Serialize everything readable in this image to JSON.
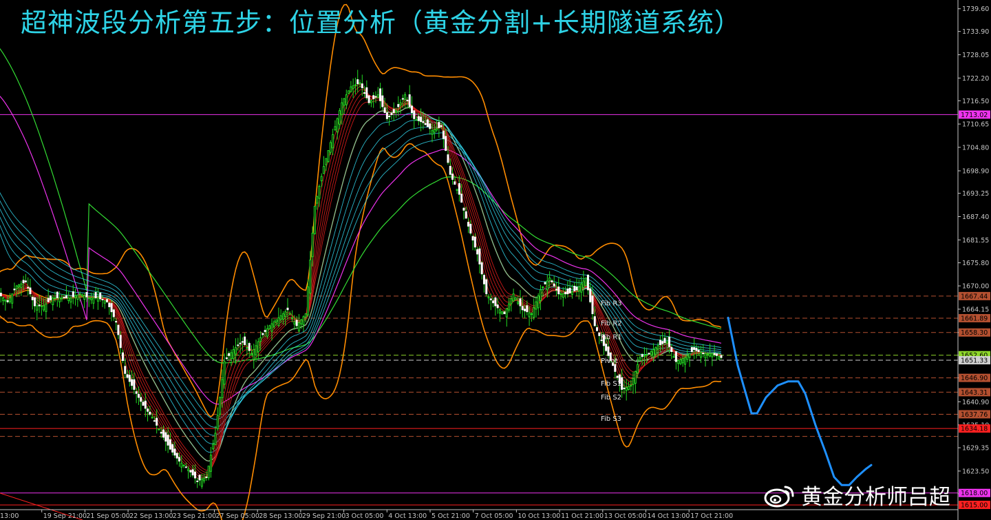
{
  "title": "超神波段分析第五步：位置分析（黄金分割+长期隧道系统）",
  "watermark": "黄金分析师吕超",
  "watermark_icon": "weibo-logo-icon",
  "colors": {
    "background": "#000000",
    "title": "#2ed3e6",
    "axis": "#c8c8c8",
    "bull_candle": "#22dd22",
    "bear_candle": "#ffffff",
    "bollinger": "#ff8c00",
    "ma_green": "#33dd33",
    "ma_magenta": "#ee33ee",
    "tunnel_cyan": "#33d8ee",
    "fast_red": "#cc1a1a",
    "forecast": "#1e90ff",
    "hline_brown": "#b45030",
    "hline_red": "#ff2020",
    "hline_magenta": "#ee33ee"
  },
  "chart_data": {
    "type": "candlestick",
    "title": "",
    "xlabel": "",
    "ylabel": "",
    "ylim": [
      1613.8,
      1741.8
    ],
    "x_ticks": [
      "13:00",
      "19 Sep 21:00",
      "21 Sep 05:00",
      "22 Sep 13:00",
      "23 Sep 21:00",
      "27 Sep 05:00",
      "28 Sep 13:00",
      "29 Sep 21:00",
      "3 Oct 05:00",
      "4 Oct 13:00",
      "5 Oct 21:00",
      "7 Oct 05:00",
      "10 Oct 13:00",
      "11 Oct 21:00",
      "13 Oct 05:00",
      "14 Oct 13:00",
      "17 Oct 21:00"
    ],
    "y_ticks": [
      "1739.60",
      "1733.90",
      "1728.05",
      "1722.20",
      "1716.50",
      "1710.65",
      "1704.80",
      "1698.90",
      "1693.25",
      "1687.40",
      "1681.55",
      "1675.80",
      "1670.00",
      "1664.15",
      "1658.30",
      "1652.60",
      "1646.90",
      "1640.90",
      "1635.10",
      "1629.35",
      "1623.50",
      "1617.80"
    ],
    "price_levels": [
      {
        "value": 1713.02,
        "label": "1713.02",
        "color": "#ee33ee",
        "style": "solid"
      },
      {
        "value": 1667.44,
        "label": "1667.44",
        "color": "#b45030",
        "style": "dashed"
      },
      {
        "value": 1661.89,
        "label": "1661.89",
        "color": "#b45030",
        "style": "dashed"
      },
      {
        "value": 1658.3,
        "label": "1658.30",
        "color": "#b45030",
        "style": "dashed"
      },
      {
        "value": 1652.6,
        "label": "1652.60",
        "color": "#8fd82a",
        "style": "dashed"
      },
      {
        "value": 1651.33,
        "label": "1651.33",
        "color": "#d0d0d0",
        "style": "dashed"
      },
      {
        "value": 1646.9,
        "label": "1646.90",
        "color": "#b45030",
        "style": "dashed"
      },
      {
        "value": 1643.31,
        "label": "1643.31",
        "color": "#b45030",
        "style": "dashed"
      },
      {
        "value": 1637.76,
        "label": "1637.76",
        "color": "#b45030",
        "style": "dashed"
      },
      {
        "value": 1634.18,
        "label": "1634.18",
        "color": "#ff2020",
        "style": "solid"
      },
      {
        "value": 1632.2,
        "label": "",
        "color": "#b45030",
        "style": "dashed"
      },
      {
        "value": 1618.0,
        "label": "1618.00",
        "color": "#ee33ee",
        "style": "solid"
      },
      {
        "value": 1615.0,
        "label": "1615.00",
        "color": "#ff2020",
        "style": "solid"
      }
    ],
    "pivot_labels": [
      {
        "label": "Fib R3",
        "value": 1665.8
      },
      {
        "label": "Fib R2",
        "value": 1660.8
      },
      {
        "label": "Fib R1",
        "value": 1657.3
      },
      {
        "label": "Pivot",
        "value": 1651.3
      },
      {
        "label": "Fib S1",
        "value": 1645.6
      },
      {
        "label": "Fib S2",
        "value": 1642.2
      },
      {
        "label": "Fib S3",
        "value": 1636.8
      }
    ],
    "close_path": [
      [
        0,
        1668
      ],
      [
        4,
        1666
      ],
      [
        8,
        1670
      ],
      [
        12,
        1671
      ],
      [
        16,
        1665
      ],
      [
        20,
        1665
      ],
      [
        24,
        1667
      ],
      [
        28,
        1667
      ],
      [
        32,
        1667
      ],
      [
        36,
        1668
      ],
      [
        40,
        1667
      ],
      [
        44,
        1667
      ],
      [
        48,
        1666
      ],
      [
        52,
        1661
      ],
      [
        56,
        1648
      ],
      [
        60,
        1644
      ],
      [
        64,
        1640
      ],
      [
        68,
        1637
      ],
      [
        72,
        1633
      ],
      [
        76,
        1629
      ],
      [
        80,
        1626
      ],
      [
        84,
        1624
      ],
      [
        88,
        1621
      ],
      [
        92,
        1622
      ],
      [
        96,
        1633
      ],
      [
        100,
        1651
      ],
      [
        104,
        1654
      ],
      [
        108,
        1656
      ],
      [
        112,
        1653
      ],
      [
        116,
        1657
      ],
      [
        120,
        1660
      ],
      [
        124,
        1662
      ],
      [
        128,
        1664
      ],
      [
        132,
        1660
      ],
      [
        136,
        1663
      ],
      [
        140,
        1690
      ],
      [
        144,
        1700
      ],
      [
        148,
        1708
      ],
      [
        152,
        1716
      ],
      [
        156,
        1720
      ],
      [
        160,
        1721
      ],
      [
        164,
        1716
      ],
      [
        168,
        1718
      ],
      [
        172,
        1712
      ],
      [
        176,
        1714
      ],
      [
        180,
        1718
      ],
      [
        184,
        1712
      ],
      [
        188,
        1711
      ],
      [
        192,
        1709
      ],
      [
        196,
        1710
      ],
      [
        200,
        1698
      ],
      [
        204,
        1693
      ],
      [
        208,
        1685
      ],
      [
        212,
        1678
      ],
      [
        216,
        1668
      ],
      [
        220,
        1665
      ],
      [
        224,
        1663
      ],
      [
        228,
        1668
      ],
      [
        232,
        1664
      ],
      [
        236,
        1663
      ],
      [
        240,
        1669
      ],
      [
        244,
        1672
      ],
      [
        248,
        1668
      ],
      [
        252,
        1668
      ],
      [
        256,
        1669
      ],
      [
        260,
        1672
      ],
      [
        264,
        1660
      ],
      [
        268,
        1655
      ],
      [
        272,
        1650
      ],
      [
        276,
        1644
      ],
      [
        280,
        1645
      ],
      [
        284,
        1652
      ],
      [
        288,
        1653
      ],
      [
        292,
        1655
      ],
      [
        296,
        1656
      ],
      [
        300,
        1651
      ],
      [
        304,
        1652
      ],
      [
        308,
        1654
      ],
      [
        312,
        1653
      ],
      [
        316,
        1653
      ],
      [
        320,
        1652
      ]
    ],
    "x_count": 321,
    "overlays": [
      {
        "name": "",
        "kind": "tunnel",
        "color": "#33d8ee"
      },
      {
        "name": "",
        "kind": "fast_ma",
        "color": "#cc1a1a"
      },
      {
        "name": "",
        "kind": "ma",
        "color": "#33dd33"
      },
      {
        "name": "",
        "kind": "ma",
        "color": "#ee33ee"
      },
      {
        "name": "",
        "kind": "bollinger",
        "color": "#ff8c00"
      }
    ],
    "forecast_path": [
      [
        1058,
        1662
      ],
      [
        1072,
        1650
      ],
      [
        1082,
        1644
      ],
      [
        1092,
        1638
      ],
      [
        1100,
        1638
      ],
      [
        1113,
        1642
      ],
      [
        1130,
        1645
      ],
      [
        1145,
        1646
      ],
      [
        1160,
        1646
      ],
      [
        1170,
        1643
      ],
      [
        1185,
        1635
      ],
      [
        1200,
        1628
      ],
      [
        1212,
        1622
      ],
      [
        1223,
        1620
      ],
      [
        1234,
        1620
      ],
      [
        1245,
        1622
      ],
      [
        1258,
        1624
      ],
      [
        1266,
        1625
      ]
    ]
  }
}
